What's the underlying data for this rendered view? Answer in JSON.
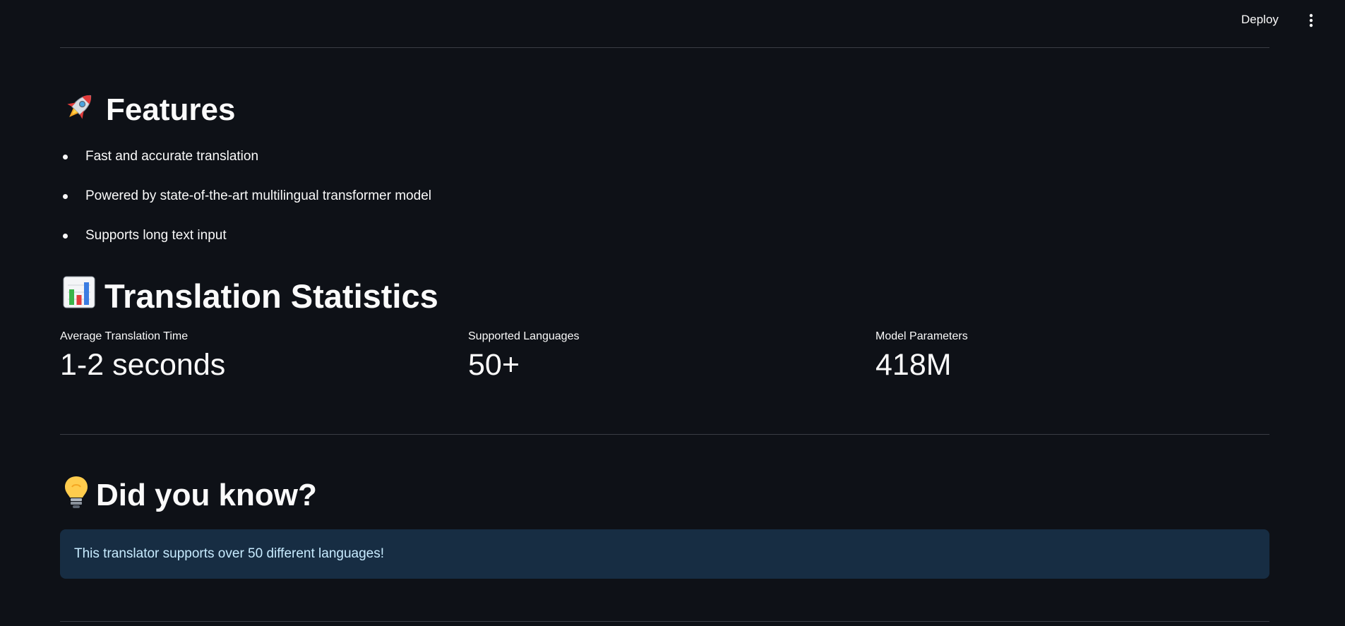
{
  "header": {
    "deploy_label": "Deploy",
    "menu_icon": "kebab-menu-icon"
  },
  "features": {
    "icon": "rocket-emoji",
    "title": "Features",
    "items": [
      "Fast and accurate translation",
      "Powered by state-of-the-art multilingual transformer model",
      "Supports long text input"
    ]
  },
  "statistics": {
    "icon": "bar-chart-emoji",
    "title": "Translation Statistics",
    "metrics": [
      {
        "label": "Average Translation Time",
        "value": "1-2 seconds"
      },
      {
        "label": "Supported Languages",
        "value": "50+"
      },
      {
        "label": "Model Parameters",
        "value": "418M"
      }
    ]
  },
  "did_you_know": {
    "icon": "light-bulb-emoji",
    "title": "Did you know?",
    "info": "This translator supports over 50 different languages!"
  },
  "colors": {
    "background": "#0e1117",
    "text": "#fafafa",
    "divider": "#3a3d45",
    "info_background": "#172d43",
    "info_text": "#c7ebff"
  }
}
